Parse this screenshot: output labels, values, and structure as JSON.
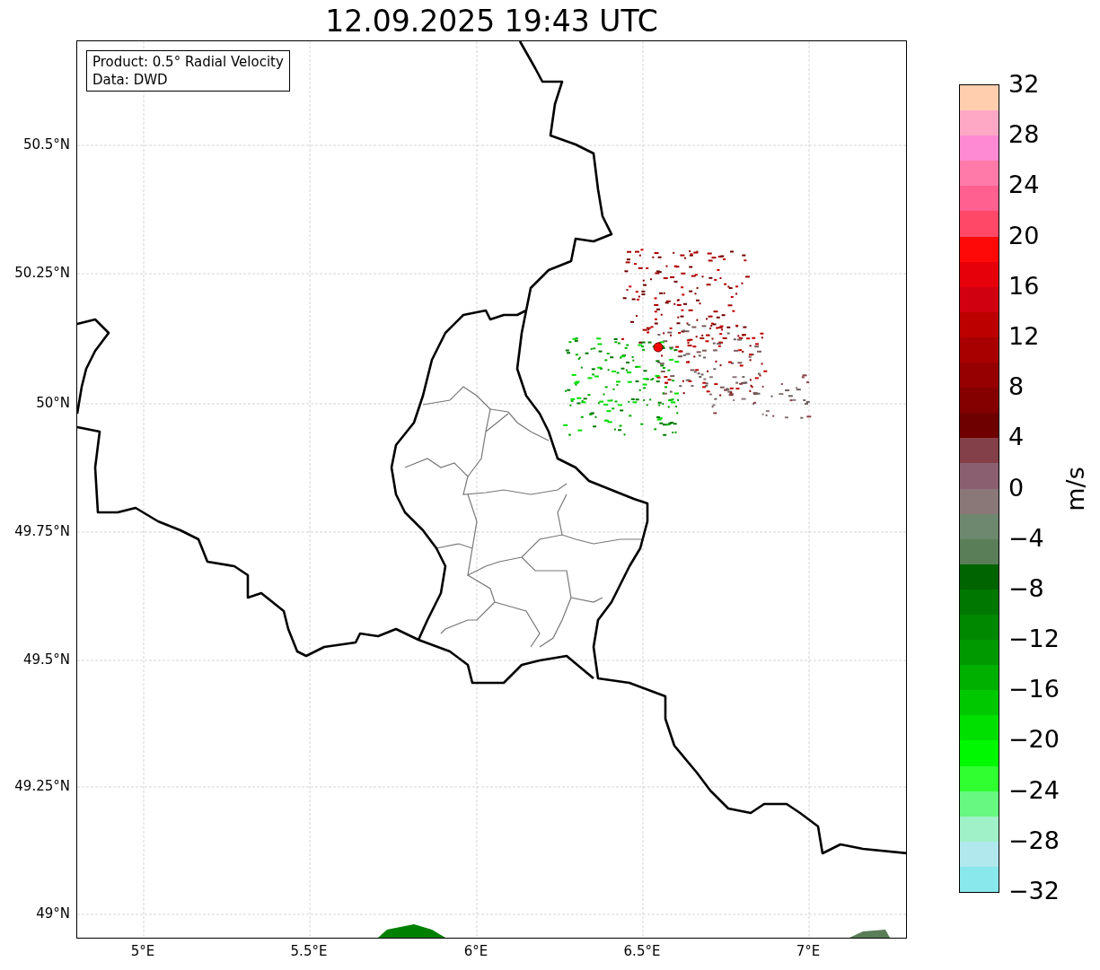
{
  "title": "12.09.2025 19:43 UTC",
  "info_box": [
    "Product: 0.5° Radial Velocity",
    "Data: DWD"
  ],
  "map": {
    "lat_ticks": [
      "50.5°N",
      "50.25°N",
      "50°N",
      "49.75°N",
      "49.5°N",
      "49.25°N",
      "49°N"
    ],
    "lon_ticks": [
      "5°E",
      "5.5°E",
      "6°E",
      "6.5°E",
      "7°E"
    ]
  },
  "colorbar": {
    "label": "m/s",
    "ticks": [
      "32",
      "28",
      "24",
      "20",
      "16",
      "12",
      "8",
      "4",
      "0",
      "−4",
      "−8",
      "−12",
      "−16",
      "−20",
      "−24",
      "−28",
      "−32"
    ],
    "bands": [
      {
        "color": "#ffceae"
      },
      {
        "color": "#ffa8c6"
      },
      {
        "color": "#ff8ad4"
      },
      {
        "color": "#ff7aa8"
      },
      {
        "color": "#ff6090"
      },
      {
        "color": "#ff4868"
      },
      {
        "color": "#ff0808"
      },
      {
        "color": "#e6000a"
      },
      {
        "color": "#d00010"
      },
      {
        "color": "#bc0000"
      },
      {
        "color": "#a80000"
      },
      {
        "color": "#960000"
      },
      {
        "color": "#840000"
      },
      {
        "color": "#6e0000"
      },
      {
        "color": "#844048"
      },
      {
        "color": "#8a6070"
      },
      {
        "color": "#8a7878"
      },
      {
        "color": "#6e8870"
      },
      {
        "color": "#5a7e58"
      },
      {
        "color": "#006400"
      },
      {
        "color": "#007800"
      },
      {
        "color": "#008800"
      },
      {
        "color": "#009a00"
      },
      {
        "color": "#00b000"
      },
      {
        "color": "#00c800"
      },
      {
        "color": "#00e000"
      },
      {
        "color": "#00f800"
      },
      {
        "color": "#30ff30"
      },
      {
        "color": "#66f880"
      },
      {
        "color": "#a0f0c8"
      },
      {
        "color": "#b0e8ee"
      },
      {
        "color": "#88e8ec"
      }
    ]
  }
}
